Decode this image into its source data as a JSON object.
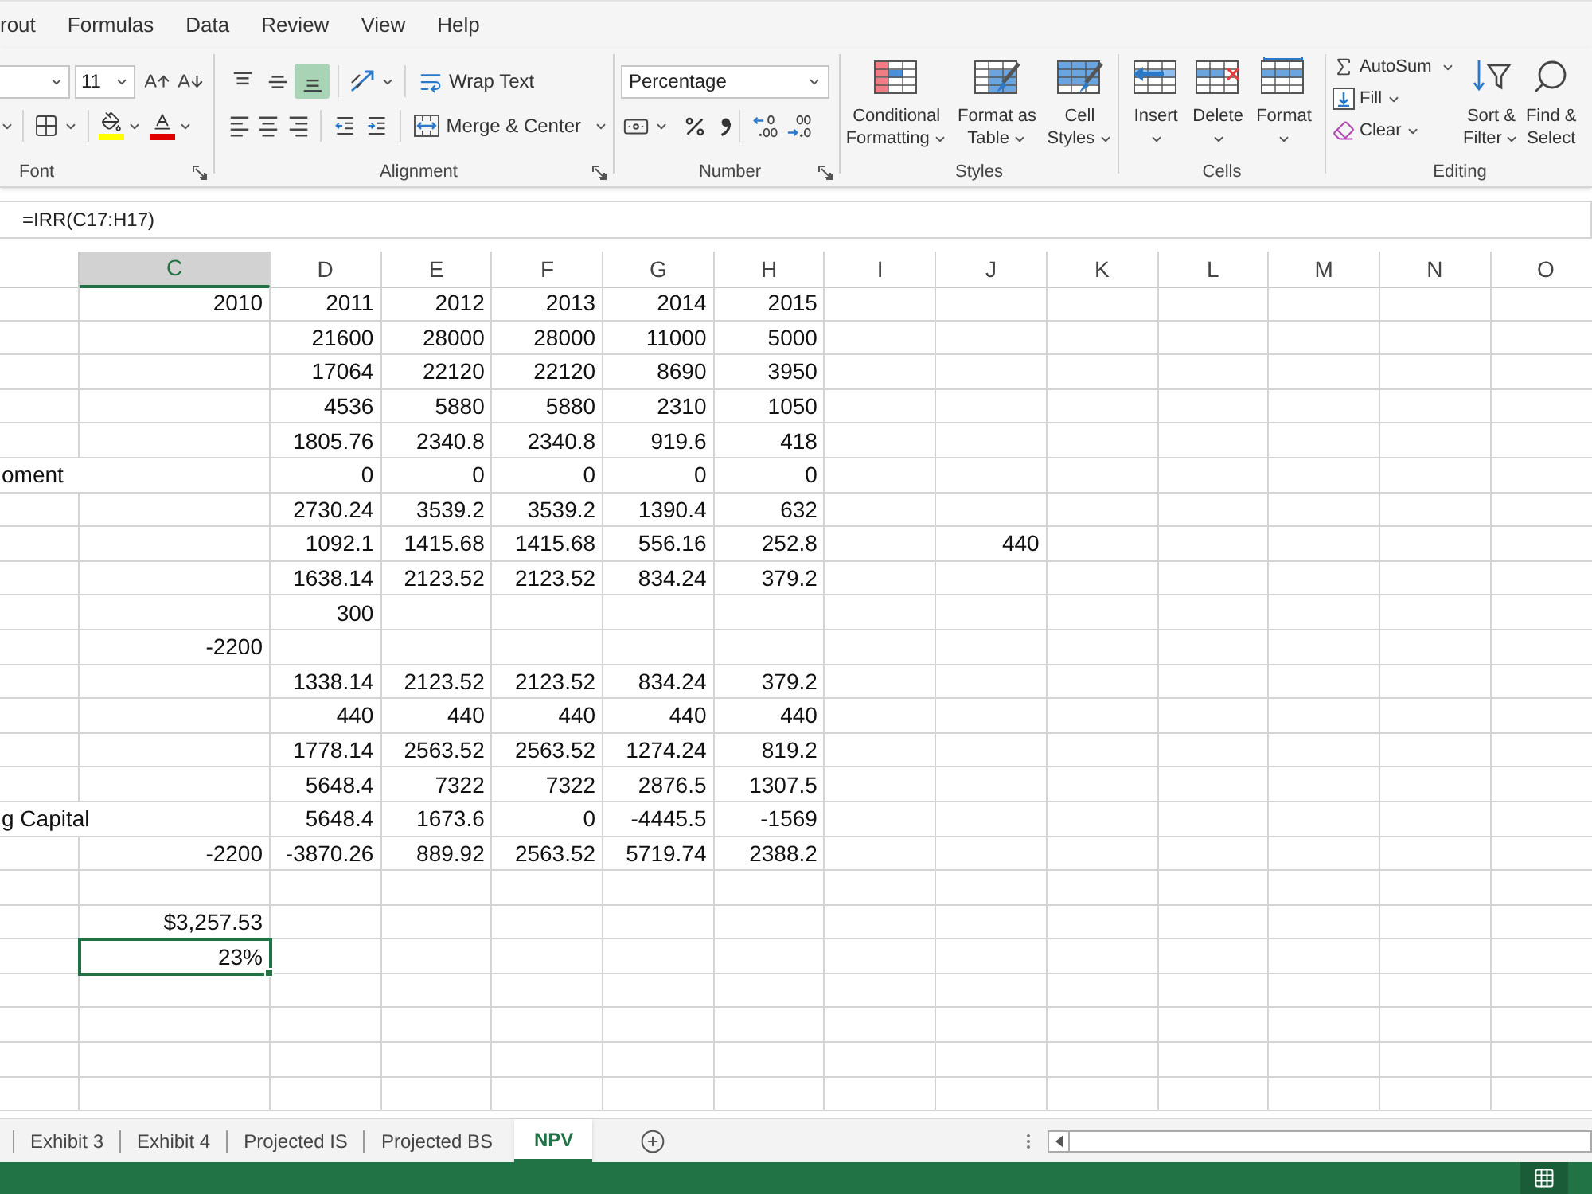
{
  "menu_tabs": [
    "rout",
    "Formulas",
    "Data",
    "Review",
    "View",
    "Help"
  ],
  "ribbon": {
    "font": {
      "label": "Font",
      "size": "11",
      "color_buttons": [
        {
          "kind": "fill",
          "color": "#ffff00"
        },
        {
          "kind": "text",
          "color": "#e00000"
        }
      ]
    },
    "alignment": {
      "label": "Alignment",
      "vertical": [
        {
          "kind": "top",
          "selected": false
        },
        {
          "kind": "middle",
          "selected": false
        },
        {
          "kind": "bottom",
          "selected": true
        }
      ],
      "horizontal": [
        {
          "kind": "left",
          "selected": false
        },
        {
          "kind": "center",
          "selected": false
        },
        {
          "kind": "right",
          "selected": false
        }
      ],
      "buttons": [
        {
          "kind": "wrap",
          "label": "Wrap Text"
        },
        {
          "kind": "merge",
          "label": "Merge & Center"
        }
      ]
    },
    "number": {
      "label": "Number",
      "format": "Percentage"
    },
    "styles": {
      "label": "Styles",
      "buttons": [
        {
          "kind": "conditional",
          "lines": [
            "Conditional",
            "Formatting"
          ]
        },
        {
          "kind": "table",
          "lines": [
            "Format as",
            "Table"
          ]
        },
        {
          "kind": "cell_styles",
          "lines": [
            "Cell",
            "Styles"
          ]
        }
      ]
    },
    "cells": {
      "label": "Cells",
      "buttons": [
        {
          "kind": "insert",
          "label": "Insert"
        },
        {
          "kind": "delete",
          "label": "Delete"
        },
        {
          "kind": "format",
          "label": "Format"
        }
      ]
    },
    "editing": {
      "label": "Editing",
      "small_buttons": [
        {
          "kind": "autosum",
          "label": "AutoSum"
        },
        {
          "kind": "fill",
          "label": "Fill"
        },
        {
          "kind": "clear",
          "label": "Clear"
        }
      ],
      "buttons": [
        {
          "kind": "sort",
          "lines": [
            "Sort &",
            "Filter"
          ]
        },
        {
          "kind": "find",
          "lines": [
            "Find &",
            "Select"
          ]
        }
      ]
    }
  },
  "formula_bar": {
    "formula": "=IRR(C17:H17)"
  },
  "sheet": {
    "columns": [
      {
        "label": "C",
        "selected": true
      },
      {
        "label": "D",
        "selected": false
      },
      {
        "label": "E",
        "selected": false
      },
      {
        "label": "F",
        "selected": false
      },
      {
        "label": "G",
        "selected": false
      },
      {
        "label": "H",
        "selected": false
      },
      {
        "label": "I",
        "selected": false
      },
      {
        "label": "J",
        "selected": false
      },
      {
        "label": "K",
        "selected": false
      },
      {
        "label": "L",
        "selected": false
      },
      {
        "label": "M",
        "selected": false
      },
      {
        "label": "N",
        "selected": false
      },
      {
        "label": "O",
        "selected": false
      }
    ],
    "rows": [
      {
        "column_c": "2010",
        "column_d": "2011",
        "column_e": "2012",
        "column_f": "2013",
        "column_g": "2014",
        "column_h": "2015",
        "selected": false
      },
      {
        "column_d": "21600",
        "column_e": "28000",
        "column_f": "28000",
        "column_g": "11000",
        "column_h": "5000",
        "selected": false
      },
      {
        "column_d": "17064",
        "column_e": "22120",
        "column_f": "22120",
        "column_g": "8690",
        "column_h": "3950",
        "selected": false
      },
      {
        "column_d": "4536",
        "column_e": "5880",
        "column_f": "5880",
        "column_g": "2310",
        "column_h": "1050",
        "selected": false
      },
      {
        "column_d": "1805.76",
        "column_e": "2340.8",
        "column_f": "2340.8",
        "column_g": "919.6",
        "column_h": "418",
        "selected": false
      },
      {
        "column_b": "oment",
        "column_d": "0",
        "column_e": "0",
        "column_f": "0",
        "column_g": "0",
        "column_h": "0",
        "selected": false
      },
      {
        "column_d": "2730.24",
        "column_e": "3539.2",
        "column_f": "3539.2",
        "column_g": "1390.4",
        "column_h": "632",
        "selected": false
      },
      {
        "column_d": "1092.1",
        "column_e": "1415.68",
        "column_f": "1415.68",
        "column_g": "556.16",
        "column_h": "252.8",
        "column_j": "440",
        "selected": false
      },
      {
        "column_d": "1638.14",
        "column_e": "2123.52",
        "column_f": "2123.52",
        "column_g": "834.24",
        "column_h": "379.2",
        "selected": false
      },
      {
        "column_d": "300",
        "selected": false
      },
      {
        "column_c": "-2200",
        "selected": false
      },
      {
        "column_d": "1338.14",
        "column_e": "2123.52",
        "column_f": "2123.52",
        "column_g": "834.24",
        "column_h": "379.2",
        "selected": false
      },
      {
        "column_d": "440",
        "column_e": "440",
        "column_f": "440",
        "column_g": "440",
        "column_h": "440",
        "selected": false
      },
      {
        "column_d": "1778.14",
        "column_e": "2563.52",
        "column_f": "2563.52",
        "column_g": "1274.24",
        "column_h": "819.2",
        "selected": false
      },
      {
        "column_d": "5648.4",
        "column_e": "7322",
        "column_f": "7322",
        "column_g": "2876.5",
        "column_h": "1307.5",
        "selected": false
      },
      {
        "column_b": "g Capital",
        "column_d": "5648.4",
        "column_e": "1673.6",
        "column_f": "0",
        "column_g": "-4445.5",
        "column_h": "-1569",
        "selected": false
      },
      {
        "column_c": "-2200",
        "column_d": "-3870.26",
        "column_e": "889.92",
        "column_f": "2563.52",
        "column_g": "5719.74",
        "column_h": "2388.2",
        "selected": false
      },
      {
        "selected": false
      },
      {
        "column_c": "$3,257.53",
        "selected": false
      },
      {
        "column_c": "23%",
        "selected": true
      }
    ]
  },
  "sheet_tabs": [
    {
      "label": "Exhibit 3",
      "selected": false
    },
    {
      "label": "Exhibit 4",
      "selected": false
    },
    {
      "label": "Projected IS",
      "selected": false
    },
    {
      "label": "Projected BS",
      "selected": false
    },
    {
      "label": "NPV",
      "selected": true
    }
  ]
}
